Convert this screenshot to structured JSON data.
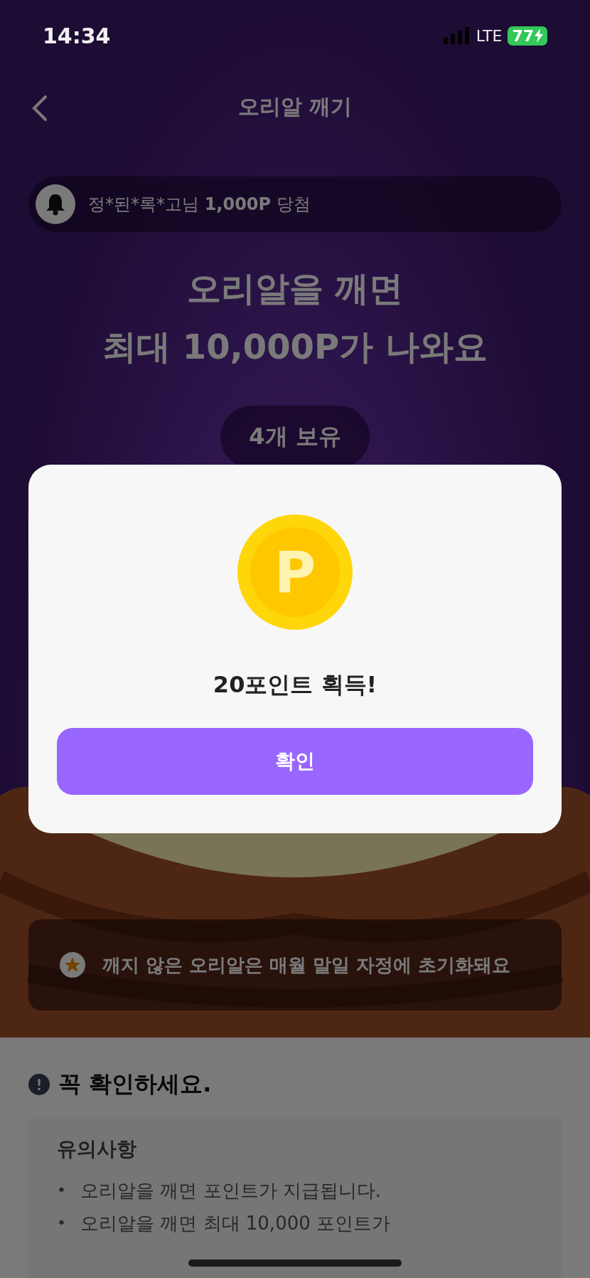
{
  "status_bar": {
    "time": "14:34",
    "network": "LTE",
    "battery": "77"
  },
  "header": {
    "title": "오리알 깨기"
  },
  "winner_notice": {
    "text": "정*된*록*고님 **1,000P** 당첨"
  },
  "headline": [
    "오리알을 깨면",
    "최대 10,000P가 나와요"
  ],
  "egg_count": "4개 보유",
  "reset_notice": "깨지 않은 오리알은 매월 말일 자정에 초기화돼요",
  "caution": {
    "title": "꼭 확인하세요.",
    "card_title": "유의사항",
    "bullet": "•",
    "items": [
      "오리알을 깨면 포인트가 지급됩니다.",
      "오리알을 깨면 최대 10,000 포인트가"
    ]
  },
  "dialog": {
    "coin_letter": "P",
    "message": "20포인트 획득!",
    "confirm": "확인"
  }
}
